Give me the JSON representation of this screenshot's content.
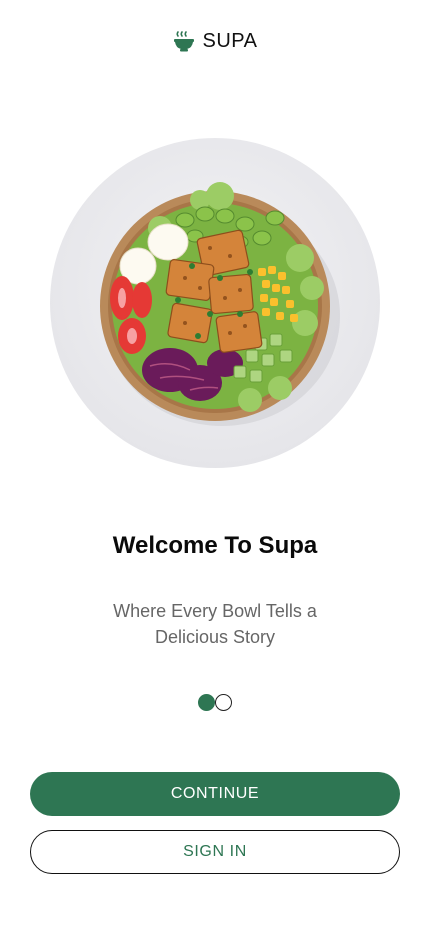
{
  "brand": {
    "name": "SUPA",
    "icon": "bowl-steam-icon",
    "color": "#2e7653"
  },
  "hero": {
    "image": "salad-bowl-image"
  },
  "welcome": {
    "title": "Welcome To Supa",
    "subtitle": "Where Every Bowl Tells a Delicious Story"
  },
  "pagination": {
    "current": 1,
    "total": 2
  },
  "actions": {
    "continue_label": "CONTINUE",
    "signin_label": "SIGN IN"
  },
  "colors": {
    "accent": "#2e7653",
    "text_primary": "#0a0a0a",
    "text_secondary": "#666666"
  }
}
